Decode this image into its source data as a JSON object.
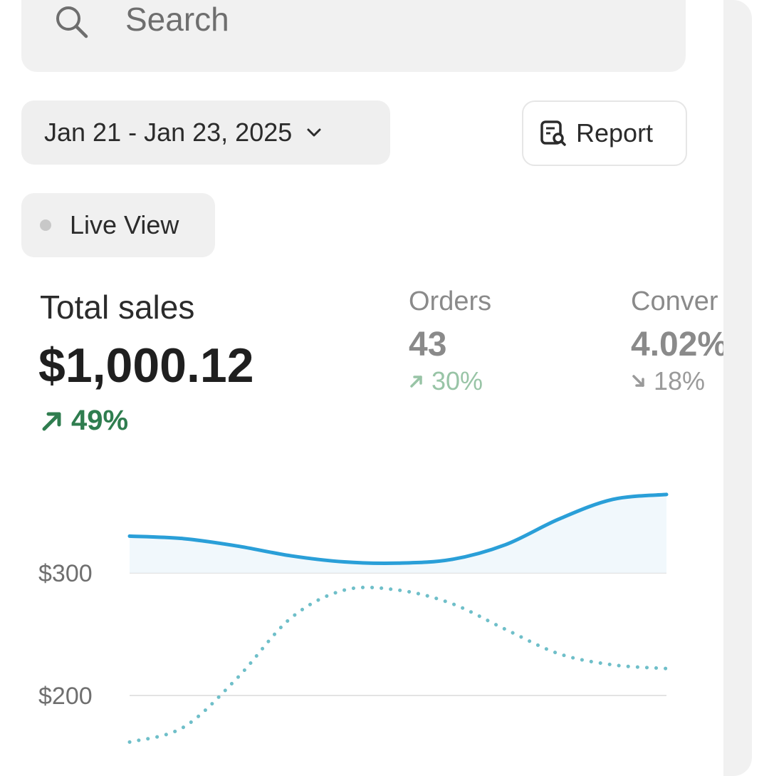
{
  "search": {
    "placeholder": "Search",
    "icon": "search-icon"
  },
  "toolbar": {
    "date_range": "Jan 21 - Jan 23, 2025",
    "date_icon": "chevron-down-icon",
    "report_label": "Report",
    "report_icon": "report-icon"
  },
  "live_view": {
    "label": "Live View"
  },
  "metrics": {
    "total_sales": {
      "label": "Total sales",
      "value": "$1,000.12",
      "delta": "49%",
      "direction": "up"
    },
    "orders": {
      "label": "Orders",
      "value": "43",
      "delta": "30%",
      "direction": "up"
    },
    "conversion": {
      "label": "Conver",
      "value": "4.02%",
      "delta": "18%",
      "direction": "down"
    }
  },
  "colors": {
    "accent_line": "#2a9fd8",
    "positive": "#2f7d4f",
    "positive_muted": "#98c4a6",
    "prior_dotted": "#6fbfc9"
  },
  "chart_data": {
    "type": "line",
    "ylabel": "",
    "y_ticks": [
      "$300",
      "$200"
    ],
    "ylim": [
      140,
      380
    ],
    "x": [
      0,
      1,
      2,
      3,
      4,
      5,
      6,
      7,
      8,
      9,
      10
    ],
    "series": [
      {
        "style": "solid",
        "values": [
          330,
          328,
          322,
          314,
          309,
          308,
          311,
          323,
          344,
          360,
          364
        ]
      },
      {
        "style": "dotted",
        "values": [
          162,
          174,
          214,
          263,
          286,
          286,
          275,
          254,
          234,
          225,
          222
        ]
      }
    ]
  }
}
